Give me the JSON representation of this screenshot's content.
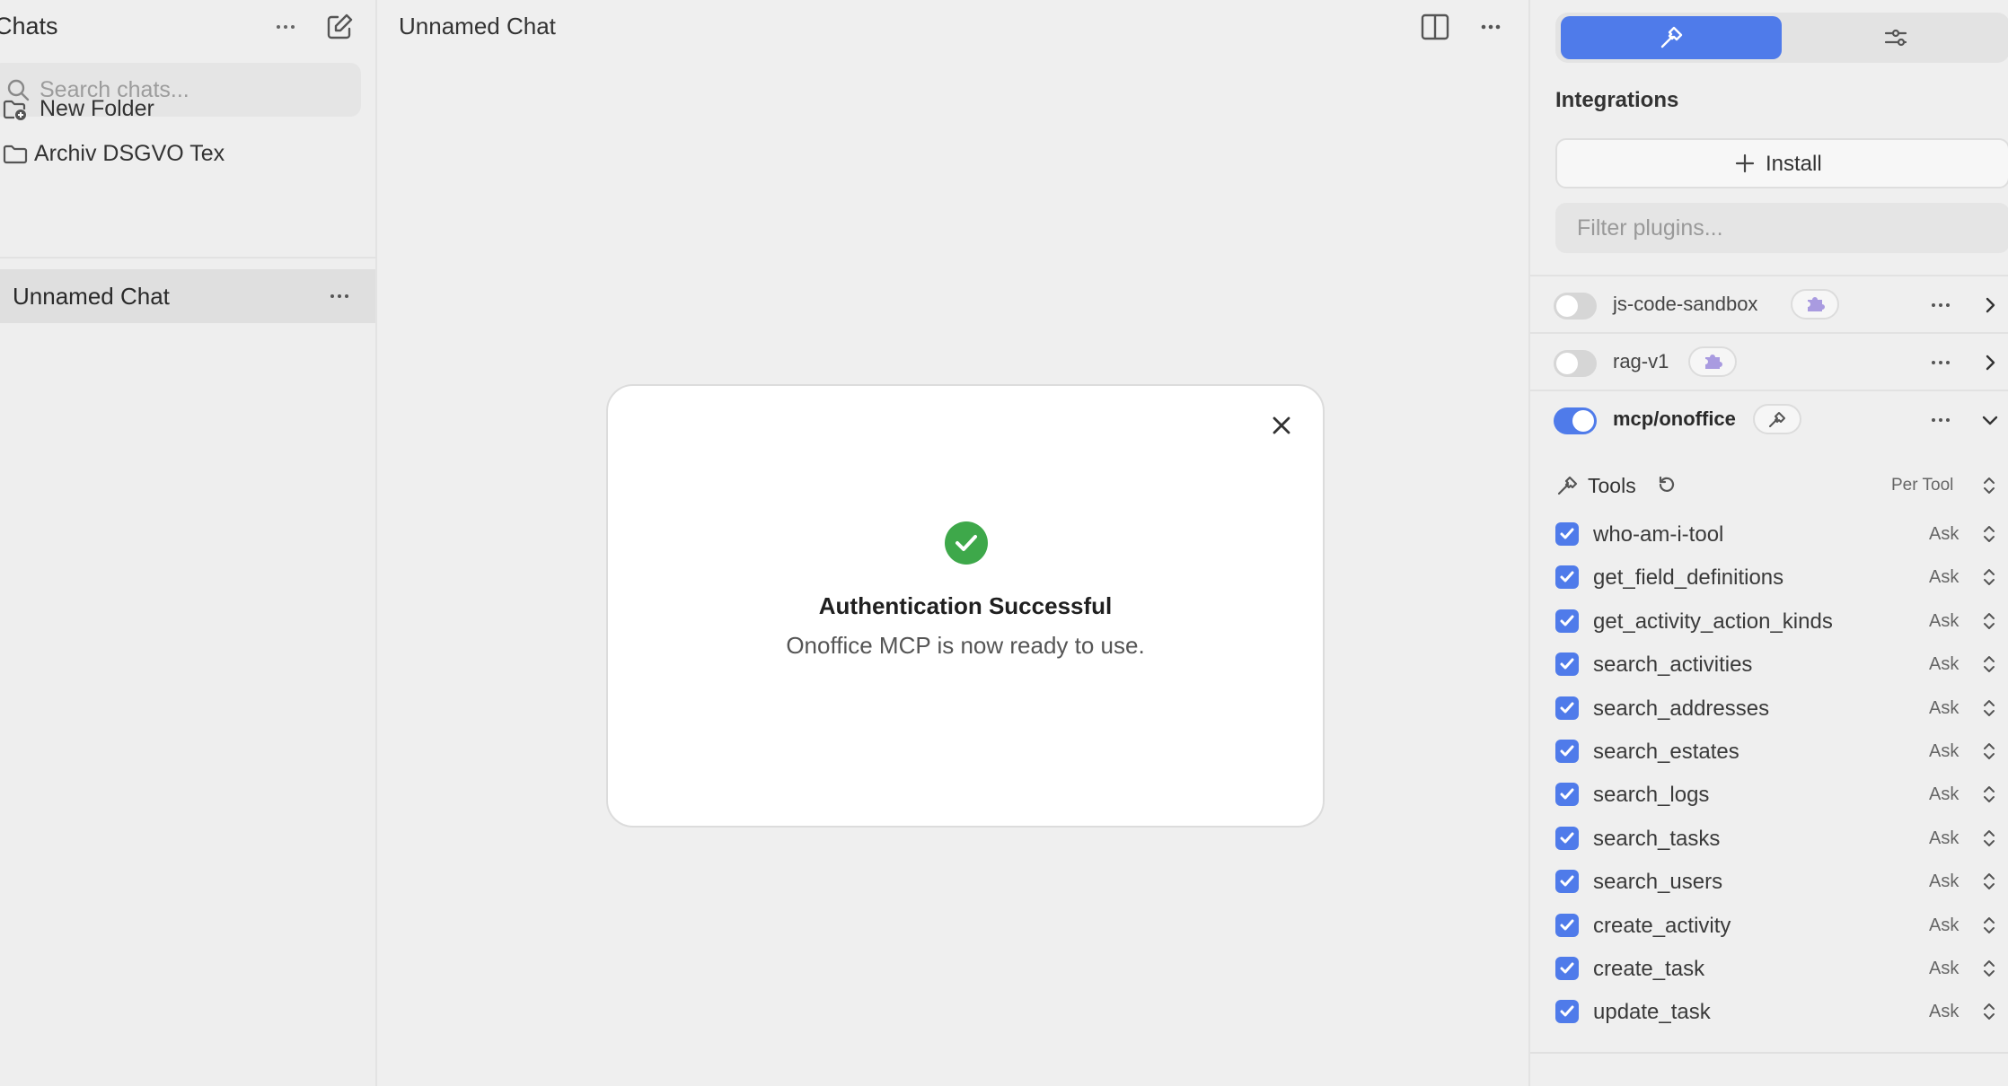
{
  "sidebar": {
    "title": "Chats",
    "search_placeholder": "Search chats...",
    "new_folder_label": "New Folder",
    "folder_label": "Archiv DSGVO Tex",
    "active_chat_label": "Unnamed Chat"
  },
  "center": {
    "title": "Unnamed Chat"
  },
  "modal": {
    "heading": "Authentication Successful",
    "message": "Onoffice MCP is now ready to use."
  },
  "right_panel": {
    "section_title": "Integrations",
    "install_label": "Install",
    "filter_placeholder": "Filter plugins...",
    "plugins": [
      {
        "name": "js-code-sandbox",
        "enabled": false,
        "expanded": false
      },
      {
        "name": "rag-v1",
        "enabled": false,
        "expanded": false
      },
      {
        "name": "mcp/onoffice",
        "enabled": true,
        "expanded": true
      }
    ],
    "tools_label": "Tools",
    "tools_mode": "Per Tool",
    "tools": [
      {
        "name": "who-am-i-tool",
        "permission": "Ask",
        "checked": true
      },
      {
        "name": "get_field_definitions",
        "permission": "Ask",
        "checked": true
      },
      {
        "name": "get_activity_action_kinds",
        "permission": "Ask",
        "checked": true
      },
      {
        "name": "search_activities",
        "permission": "Ask",
        "checked": true
      },
      {
        "name": "search_addresses",
        "permission": "Ask",
        "checked": true
      },
      {
        "name": "search_estates",
        "permission": "Ask",
        "checked": true
      },
      {
        "name": "search_logs",
        "permission": "Ask",
        "checked": true
      },
      {
        "name": "search_tasks",
        "permission": "Ask",
        "checked": true
      },
      {
        "name": "search_users",
        "permission": "Ask",
        "checked": true
      },
      {
        "name": "create_activity",
        "permission": "Ask",
        "checked": true
      },
      {
        "name": "create_task",
        "permission": "Ask",
        "checked": true
      },
      {
        "name": "update_task",
        "permission": "Ask",
        "checked": true
      }
    ]
  },
  "colors": {
    "accent": "#4f7bea",
    "success": "#3ea84a",
    "background": "#efefef",
    "modal_bg": "#ffffff"
  }
}
